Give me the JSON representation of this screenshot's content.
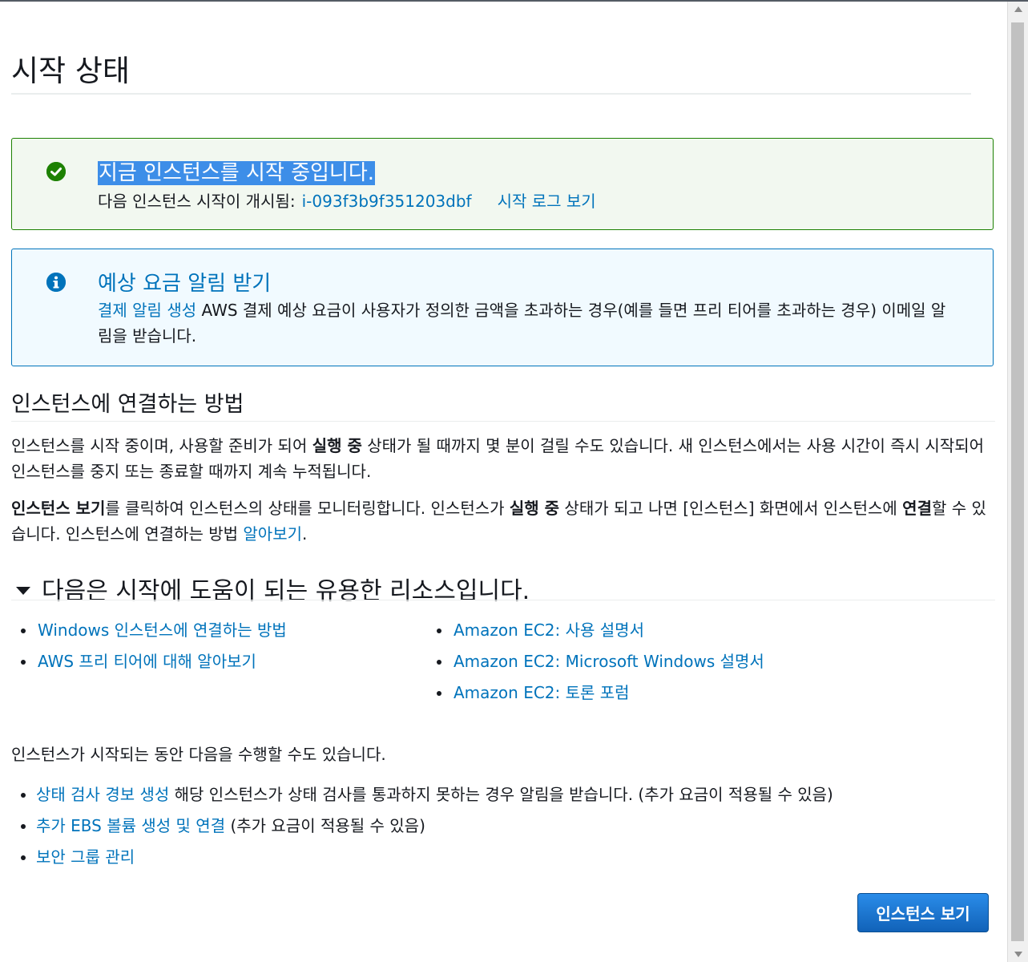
{
  "page": {
    "title": "시작 상태"
  },
  "success_alert": {
    "heading": "지금 인스턴스를 시작 중입니다.",
    "sub_text": "다음 인스턴스 시작이 개시됨:",
    "instance_id": "i-093f3b9f351203dbf",
    "log_link": "시작 로그 보기",
    "icon": "check-circle-icon",
    "color": "#1d8102"
  },
  "info_alert": {
    "heading": "예상 요금 알림 받기",
    "link": "결제 알림 생성",
    "text": " AWS 결제 예상 요금이 사용자가 정의한 금액을 초과하는 경우(예를 들면 프리 티어를 초과하는 경우) 이메일 알림을 받습니다.",
    "icon": "info-icon",
    "color": "#0073bb"
  },
  "connect_section": {
    "title": "인스턴스에 연결하는 방법",
    "p1_a": "인스턴스를 시작 중이며, 사용할 준비가 되어 ",
    "p1_bold": "실행 중",
    "p1_b": " 상태가 될 때까지 몇 분이 걸릴 수도 있습니다. 새 인스턴스에서는 사용 시간이 즉시 시작되어 인스턴스를 중지 또는 종료할 때까지 계속 누적됩니다.",
    "p2_bold1": "인스턴스 보기",
    "p2_a": "를 클릭하여 인스턴스의 상태를 모니터링합니다. 인스턴스가 ",
    "p2_bold2": "실행 중",
    "p2_b": " 상태가 되고 나면 [인스턴스] 화면에서 인스턴스에 ",
    "p2_bold3": "연결",
    "p2_c": "할 수 있습니다. 인스턴스에 연결하는 방법 ",
    "p2_link": "알아보기",
    "p2_end": "."
  },
  "resources_section": {
    "title": "다음은 시작에 도움이 되는 유용한 리소스입니다.",
    "left_links": [
      "Windows 인스턴스에 연결하는 방법",
      "AWS 프리 티어에 대해 알아보기"
    ],
    "right_links": [
      "Amazon EC2: 사용 설명서",
      "Amazon EC2: Microsoft Windows 설명서",
      "Amazon EC2: 토론 포럼"
    ]
  },
  "actions_section": {
    "intro": "인스턴스가 시작되는 동안 다음을 수행할 수도 있습니다.",
    "items": [
      {
        "link": "상태 검사 경보 생성",
        "text": " 해당 인스턴스가 상태 검사를 통과하지 못하는 경우 알림을 받습니다. (추가 요금이 적용될 수 있음)"
      },
      {
        "link": "추가 EBS 볼륨 생성 및 연결",
        "text": " (추가 요금이 적용될 수 있음)"
      },
      {
        "link": "보안 그룹 관리",
        "text": ""
      }
    ]
  },
  "footer": {
    "view_instances_button": "인스턴스 보기"
  }
}
